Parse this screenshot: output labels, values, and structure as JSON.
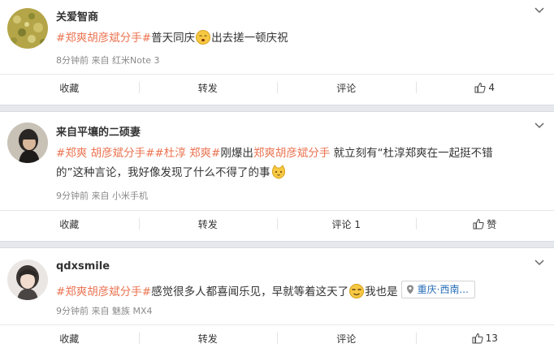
{
  "posts": [
    {
      "username": "关爱智商",
      "content": {
        "tag1": "#郑爽胡彦斌分手#",
        "text1": "普天同庆",
        "text2": "出去搓一顿庆祝"
      },
      "meta": {
        "time": "8分钟前",
        "from": "来自",
        "device": "红米Note 3"
      },
      "actions": {
        "favorite": "收藏",
        "repost": "转发",
        "comment": "评论",
        "like": "4"
      }
    },
    {
      "username": "来自平壤的二硕妻",
      "content": {
        "tag1": "#郑爽 胡彦斌分手#",
        "tag2": "#杜淳 郑爽#",
        "text1": "刚爆出",
        "tag3": "郑爽胡彦斌分手",
        "text2": " 就立刻有“杜淳郑爽在一起挺不错的”这种言论，我好像发现了什么不得了的事"
      },
      "meta": {
        "time": "9分钟前",
        "from": "来自",
        "device": "小米手机"
      },
      "actions": {
        "favorite": "收藏",
        "repost": "转发",
        "comment": "评论 1",
        "like": "赞"
      }
    },
    {
      "username": "qdxsmile",
      "content": {
        "tag1": "#郑爽胡彦斌分手#",
        "text1": "感觉很多人都喜闻乐见，早就等着这天了",
        "text2": "我也是",
        "location": "重庆·西南..."
      },
      "meta": {
        "time": "9分钟前",
        "from": "来自",
        "device": "魅族 MX4"
      },
      "actions": {
        "favorite": "收藏",
        "repost": "转发",
        "comment": "评论",
        "like": "13"
      }
    }
  ],
  "colors": {
    "hashtag": "#eb7350",
    "link": "#2a6fb8",
    "meta": "#8a8a8a",
    "separator": "#e6e8ec"
  },
  "icons": [
    "chevron-down-icon",
    "thumbs-up-icon",
    "location-pin-icon",
    "emoji-icon"
  ]
}
